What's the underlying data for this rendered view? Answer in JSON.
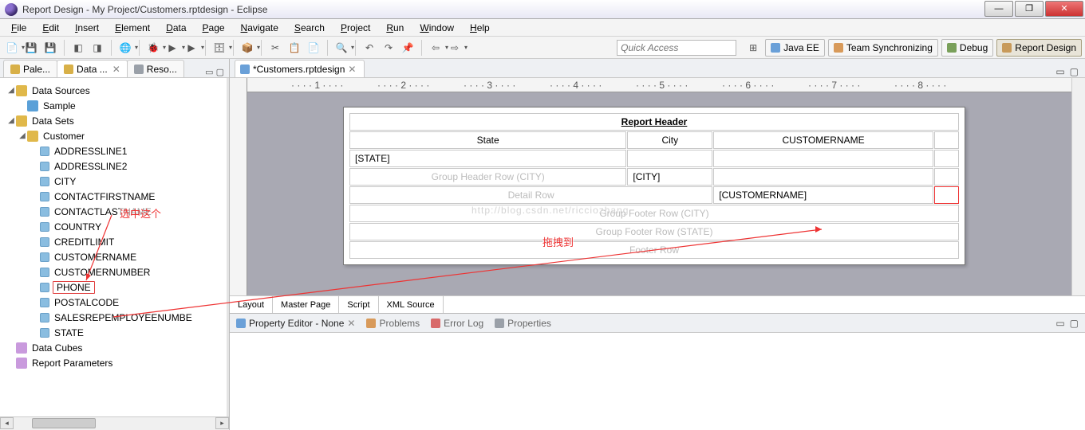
{
  "title": "Report Design - My Project/Customers.rptdesign - Eclipse",
  "menus": [
    "File",
    "Edit",
    "Insert",
    "Element",
    "Data",
    "Page",
    "Navigate",
    "Search",
    "Project",
    "Run",
    "Window",
    "Help"
  ],
  "quick_access_placeholder": "Quick Access",
  "perspectives": [
    {
      "label": "Java EE",
      "icon": "#6aa0d8"
    },
    {
      "label": "Team Synchronizing",
      "icon": "#d89a5a"
    },
    {
      "label": "Debug",
      "icon": "#7aa05a"
    },
    {
      "label": "Report Design",
      "icon": "#c89a5a",
      "active": true
    }
  ],
  "left_tabs": [
    {
      "label": "Pale...",
      "icon": "#d8b048"
    },
    {
      "label": "Data ...",
      "icon": "#d8b048",
      "active": true,
      "closable": true
    },
    {
      "label": "Reso...",
      "icon": "#9aa0a8"
    }
  ],
  "tree": {
    "data_sources": {
      "label": "Data Sources",
      "children": [
        {
          "label": "Sample",
          "icon": "sample"
        }
      ]
    },
    "data_sets": {
      "label": "Data Sets",
      "children": [
        {
          "label": "Customer",
          "expanded": true,
          "columns": [
            "ADDRESSLINE1",
            "ADDRESSLINE2",
            "CITY",
            "CONTACTFIRSTNAME",
            "CONTACTLASTNAME",
            "COUNTRY",
            "CREDITLIMIT",
            "CUSTOMERNAME",
            "CUSTOMERNUMBER",
            "PHONE",
            "POSTALCODE",
            "SALESREPEMPLOYEENUMBE",
            "STATE"
          ],
          "selected": "PHONE"
        }
      ]
    },
    "data_cubes": {
      "label": "Data Cubes"
    },
    "report_parameters": {
      "label": "Report Parameters"
    }
  },
  "editor_tab": "*Customers.rptdesign",
  "ruler_ticks": [
    "1",
    "2",
    "3",
    "4",
    "5",
    "6",
    "7",
    "8"
  ],
  "report": {
    "header_label": "Report Header",
    "columns": [
      "State",
      "City",
      "CUSTOMERNAME",
      ""
    ],
    "state_cell": "[STATE]",
    "city_cell": "[CITY]",
    "custname_cell": "[CUSTOMERNAME]",
    "ghrow_city": "Group Header Row (CITY)",
    "detail_row": "Detail Row",
    "gfrow_city": "Group Footer Row (CITY)",
    "gfrow_state": "Group Footer Row (STATE)",
    "footer_row": "Footer Row"
  },
  "watermark": "http://blog.csdn.net/ricciozhang",
  "bottom_tabs": [
    "Layout",
    "Master Page",
    "Script",
    "XML Source"
  ],
  "prop_tabs": [
    {
      "label": "Property Editor - None",
      "active": true,
      "closable": true,
      "icon": "#6aa0d8"
    },
    {
      "label": "Problems",
      "icon": "#d89a5a"
    },
    {
      "label": "Error Log",
      "icon": "#d86a6a"
    },
    {
      "label": "Properties",
      "icon": "#9aa0a8"
    }
  ],
  "annotations": {
    "select_this": "选中这个",
    "drag_to": "拖拽到"
  }
}
